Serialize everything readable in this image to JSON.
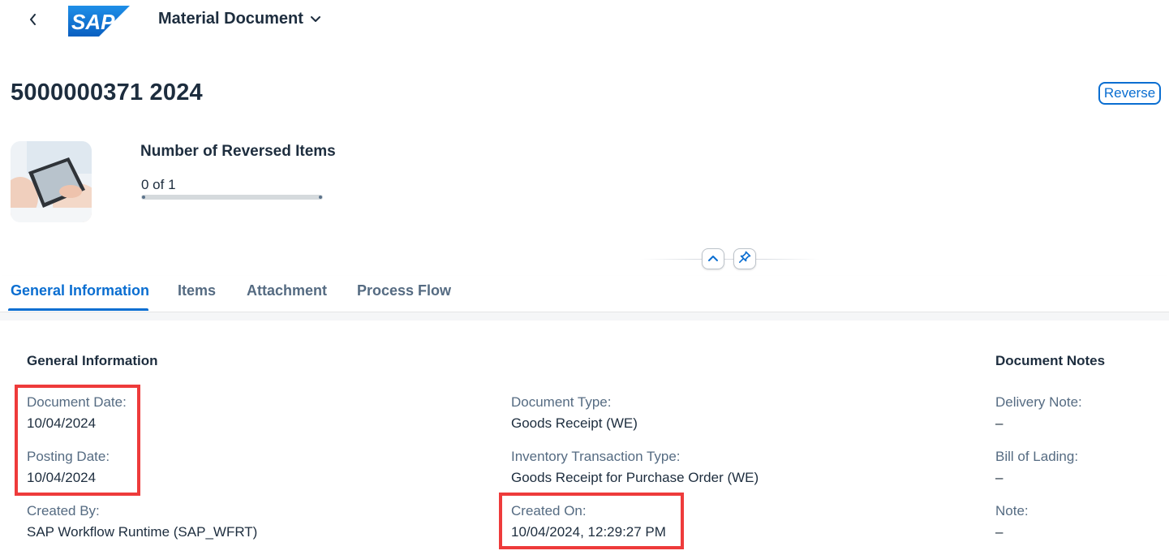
{
  "shell": {
    "app_title": "Material Document",
    "logo_text": "SAP"
  },
  "header": {
    "object_title": "5000000371 2024",
    "reverse_label": "Reverse",
    "kpi": {
      "label": "Number of Reversed Items",
      "progress_text": "0 of 1",
      "progress_fraction": 0
    }
  },
  "tabs": [
    {
      "label": "General Information",
      "active": true
    },
    {
      "label": "Items",
      "active": false
    },
    {
      "label": "Attachment",
      "active": false
    },
    {
      "label": "Process Flow",
      "active": false
    }
  ],
  "general_info": {
    "title": "General Information",
    "document_date": {
      "label": "Document Date:",
      "value": "10/04/2024"
    },
    "posting_date": {
      "label": "Posting Date:",
      "value": "10/04/2024"
    },
    "created_by": {
      "label": "Created By:",
      "value": "SAP Workflow Runtime (SAP_WFRT)"
    },
    "document_type": {
      "label": "Document Type:",
      "value": "Goods Receipt (WE)"
    },
    "inventory_transaction_type": {
      "label": "Inventory Transaction Type:",
      "value": "Goods Receipt for Purchase Order (WE)"
    },
    "created_on": {
      "label": "Created On:",
      "value": "10/04/2024, 12:29:27 PM"
    }
  },
  "document_notes": {
    "title": "Document Notes",
    "delivery_note": {
      "label": "Delivery Note:",
      "value": "–"
    },
    "bill_of_lading": {
      "label": "Bill of Lading:",
      "value": "–"
    },
    "note": {
      "label": "Note:",
      "value": "–"
    }
  },
  "colors": {
    "accent": "#0a6ed1",
    "highlight": "#ee3b3b",
    "text": "#1d2d3e",
    "label": "#556b82",
    "logo_blue": "#0a73d8"
  }
}
